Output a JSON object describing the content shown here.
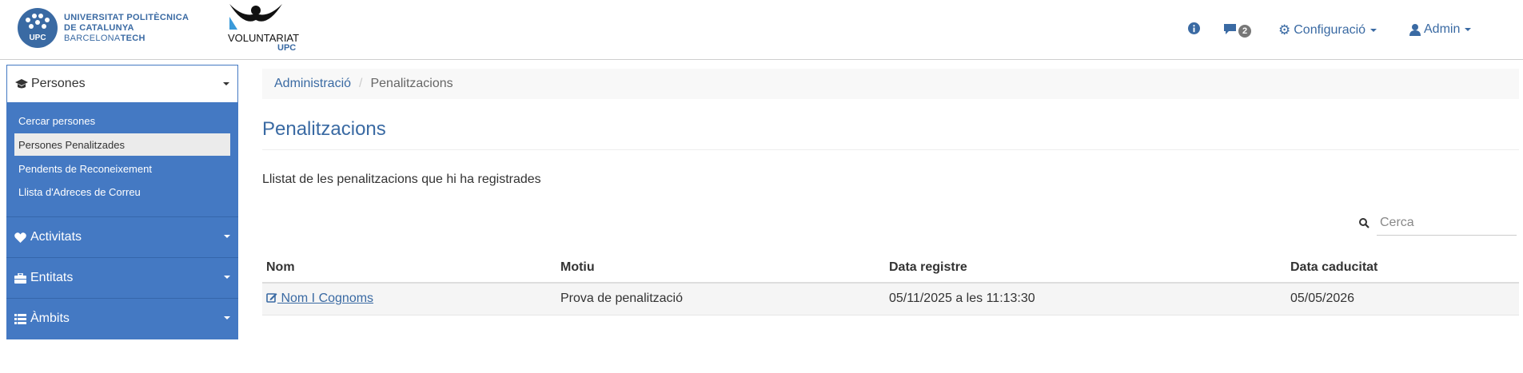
{
  "header": {
    "upc_logo": {
      "circle_text": "UPC",
      "line1": "UNIVERSITAT POLITÈCNICA",
      "line2": "DE CATALUNYA",
      "line3_light": "BARCELONA",
      "line3_bold": "TECH"
    },
    "volunteer_logo": {
      "word": "VOLUNTARIAT",
      "sub": "UPC"
    },
    "nav": {
      "messages_count": "2",
      "config_label": "Configuració",
      "user_label": "Admin"
    }
  },
  "sidebar": {
    "active_section": "Persones",
    "sub_items": [
      {
        "label": "Cercar persones"
      },
      {
        "label": "Persones Penalitzades",
        "active": true
      },
      {
        "label": "Pendents de Reconeixement"
      },
      {
        "label": "Llista d'Adreces de Correu"
      }
    ],
    "sections": [
      {
        "label": "Activitats",
        "icon": "heart-icon"
      },
      {
        "label": "Entitats",
        "icon": "briefcase-icon"
      },
      {
        "label": "Àmbits",
        "icon": "list-icon"
      }
    ]
  },
  "breadcrumb": {
    "parent": "Administració",
    "separator": "/",
    "current": "Penalitzacions"
  },
  "page": {
    "title": "Penalitzacions",
    "intro": "Llistat de les penalitzacions que hi ha registrades"
  },
  "search": {
    "placeholder": "Cerca"
  },
  "table": {
    "headers": [
      "Nom",
      "Motiu",
      "Data registre",
      "Data caducitat"
    ],
    "rows": [
      {
        "nom": "Nom I Cognoms",
        "motiu": "Prova de penalització",
        "registre": "05/11/2025 a les 11:13:30",
        "caducitat": "05/05/2026"
      }
    ]
  },
  "colors": {
    "brand": "#3a6aa3",
    "sidebar": "#4479c3"
  }
}
